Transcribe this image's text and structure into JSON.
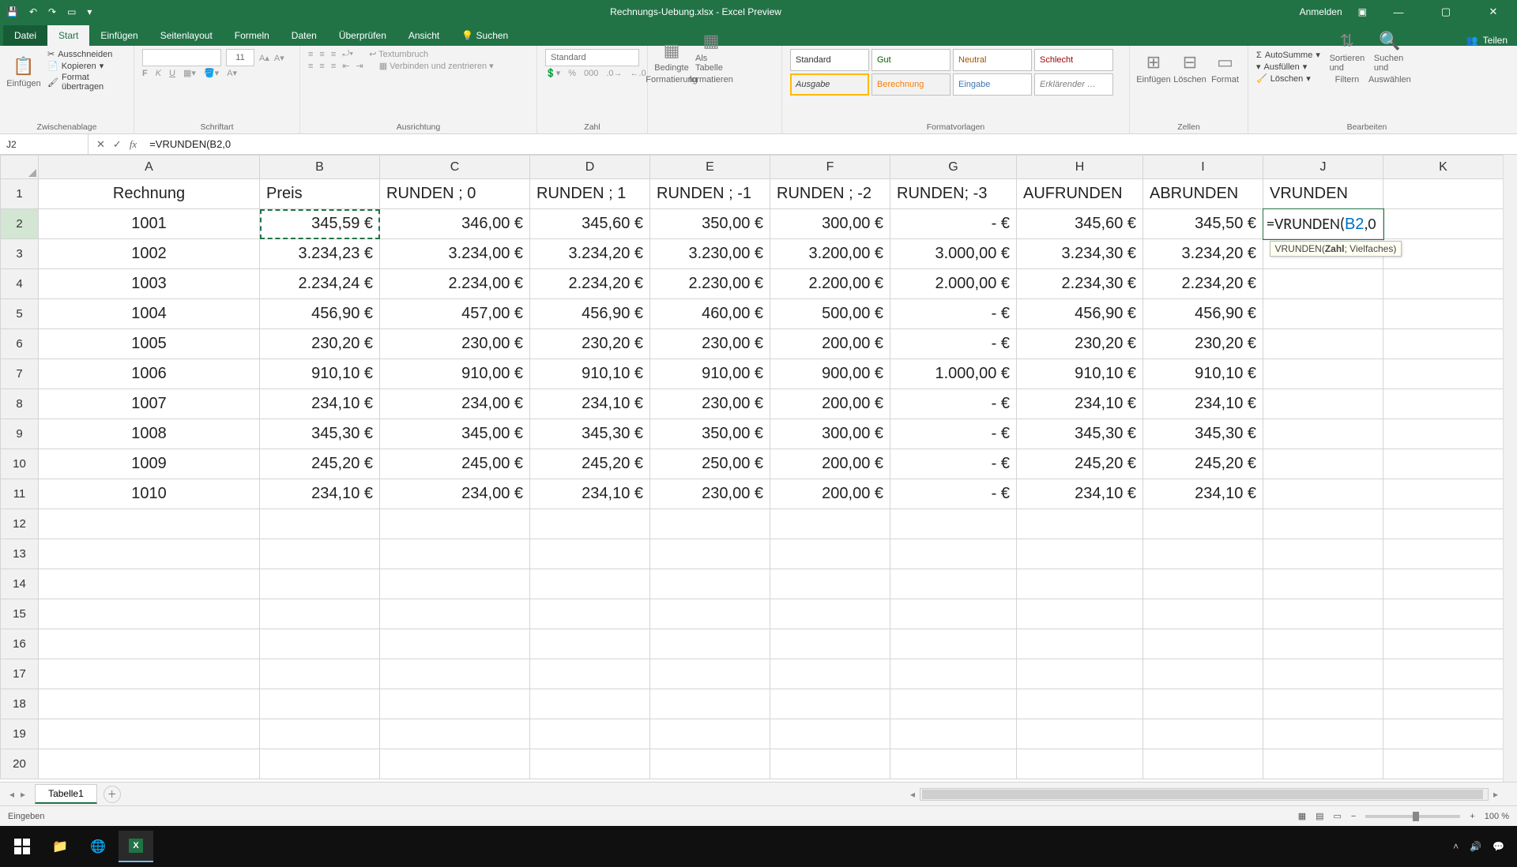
{
  "titlebar": {
    "doc": "Rechnungs-Uebung.xlsx - Excel Preview",
    "signin": "Anmelden"
  },
  "tabs": {
    "file": "Datei",
    "items": [
      "Start",
      "Einfügen",
      "Seitenlayout",
      "Formeln",
      "Daten",
      "Überprüfen",
      "Ansicht"
    ],
    "search_icon_label": "Suchen",
    "share": "Teilen"
  },
  "ribbon": {
    "clipboard": {
      "paste": "Einfügen",
      "cut": "Ausschneiden",
      "copy": "Kopieren",
      "formatpainter": "Format übertragen",
      "label": "Zwischenablage"
    },
    "font": {
      "size": "11",
      "label": "Schriftart",
      "buttons": [
        "F",
        "K",
        "U"
      ]
    },
    "align": {
      "wrap": "Textumbruch",
      "merge": "Verbinden und zentrieren",
      "label": "Ausrichtung"
    },
    "number": {
      "format": "Standard",
      "label": "Zahl"
    },
    "cond": {
      "cond": "Bedingte",
      "cond2": "Formatierung",
      "table": "Als Tabelle",
      "table2": "formatieren"
    },
    "styles": {
      "standard": "Standard",
      "gut": "Gut",
      "neutral": "Neutral",
      "schlecht": "Schlecht",
      "ausgabe": "Ausgabe",
      "berechnung": "Berechnung",
      "eingabe": "Eingabe",
      "erkl": "Erklärender …",
      "label": "Formatvorlagen"
    },
    "cells": {
      "insert": "Einfügen",
      "delete": "Löschen",
      "format": "Format",
      "label": "Zellen"
    },
    "editing": {
      "autosum": "AutoSumme",
      "fill": "Ausfüllen",
      "clear": "Löschen",
      "sort": "Sortieren und",
      "sort2": "Filtern",
      "find": "Suchen und",
      "find2": "Auswählen",
      "label": "Bearbeiten"
    }
  },
  "formulabar": {
    "name": "J2",
    "formula": "=VRUNDEN(B2,0"
  },
  "tooltip": {
    "fn": "VRUNDEN(",
    "arg1": "Zahl",
    "rest": "; Vielfaches)"
  },
  "headers": [
    "A",
    "B",
    "C",
    "D",
    "E",
    "F",
    "G",
    "H",
    "I",
    "J",
    "K"
  ],
  "row1": [
    "Rechnung",
    "Preis",
    "RUNDEN ; 0",
    "RUNDEN ; 1",
    "RUNDEN ; -1",
    "RUNDEN ; -2",
    "RUNDEN; -3",
    "AUFRUNDEN",
    "ABRUNDEN",
    "VRUNDEN",
    ""
  ],
  "j2_edit": {
    "prefix": "=VRUNDEN(",
    "ref": "B2",
    "suffix": ",0"
  },
  "rows": [
    {
      "n": "2",
      "a": "1001",
      "b": "345,59 €",
      "c": "346,00 €",
      "d": "345,60 €",
      "e": "350,00 €",
      "f": "300,00 €",
      "g": "-     €",
      "h": "345,60 €",
      "i": "345,50 €"
    },
    {
      "n": "3",
      "a": "1002",
      "b": "3.234,23 €",
      "c": "3.234,00 €",
      "d": "3.234,20 €",
      "e": "3.230,00 €",
      "f": "3.200,00 €",
      "g": "3.000,00 €",
      "h": "3.234,30 €",
      "i": "3.234,20 €"
    },
    {
      "n": "4",
      "a": "1003",
      "b": "2.234,24 €",
      "c": "2.234,00 €",
      "d": "2.234,20 €",
      "e": "2.230,00 €",
      "f": "2.200,00 €",
      "g": "2.000,00 €",
      "h": "2.234,30 €",
      "i": "2.234,20 €"
    },
    {
      "n": "5",
      "a": "1004",
      "b": "456,90 €",
      "c": "457,00 €",
      "d": "456,90 €",
      "e": "460,00 €",
      "f": "500,00 €",
      "g": "-     €",
      "h": "456,90 €",
      "i": "456,90 €"
    },
    {
      "n": "6",
      "a": "1005",
      "b": "230,20 €",
      "c": "230,00 €",
      "d": "230,20 €",
      "e": "230,00 €",
      "f": "200,00 €",
      "g": "-     €",
      "h": "230,20 €",
      "i": "230,20 €"
    },
    {
      "n": "7",
      "a": "1006",
      "b": "910,10 €",
      "c": "910,00 €",
      "d": "910,10 €",
      "e": "910,00 €",
      "f": "900,00 €",
      "g": "1.000,00 €",
      "h": "910,10 €",
      "i": "910,10 €"
    },
    {
      "n": "8",
      "a": "1007",
      "b": "234,10 €",
      "c": "234,00 €",
      "d": "234,10 €",
      "e": "230,00 €",
      "f": "200,00 €",
      "g": "-     €",
      "h": "234,10 €",
      "i": "234,10 €"
    },
    {
      "n": "9",
      "a": "1008",
      "b": "345,30 €",
      "c": "345,00 €",
      "d": "345,30 €",
      "e": "350,00 €",
      "f": "300,00 €",
      "g": "-     €",
      "h": "345,30 €",
      "i": "345,30 €"
    },
    {
      "n": "10",
      "a": "1009",
      "b": "245,20 €",
      "c": "245,00 €",
      "d": "245,20 €",
      "e": "250,00 €",
      "f": "200,00 €",
      "g": "-     €",
      "h": "245,20 €",
      "i": "245,20 €"
    },
    {
      "n": "11",
      "a": "1010",
      "b": "234,10 €",
      "c": "234,00 €",
      "d": "234,10 €",
      "e": "230,00 €",
      "f": "200,00 €",
      "g": "-     €",
      "h": "234,10 €",
      "i": "234,10 €"
    }
  ],
  "emptyrows": [
    "12",
    "13",
    "14",
    "15",
    "16",
    "17",
    "18",
    "19",
    "20"
  ],
  "sheettab": "Tabelle1",
  "status": "Eingeben",
  "zoom": "100 %"
}
